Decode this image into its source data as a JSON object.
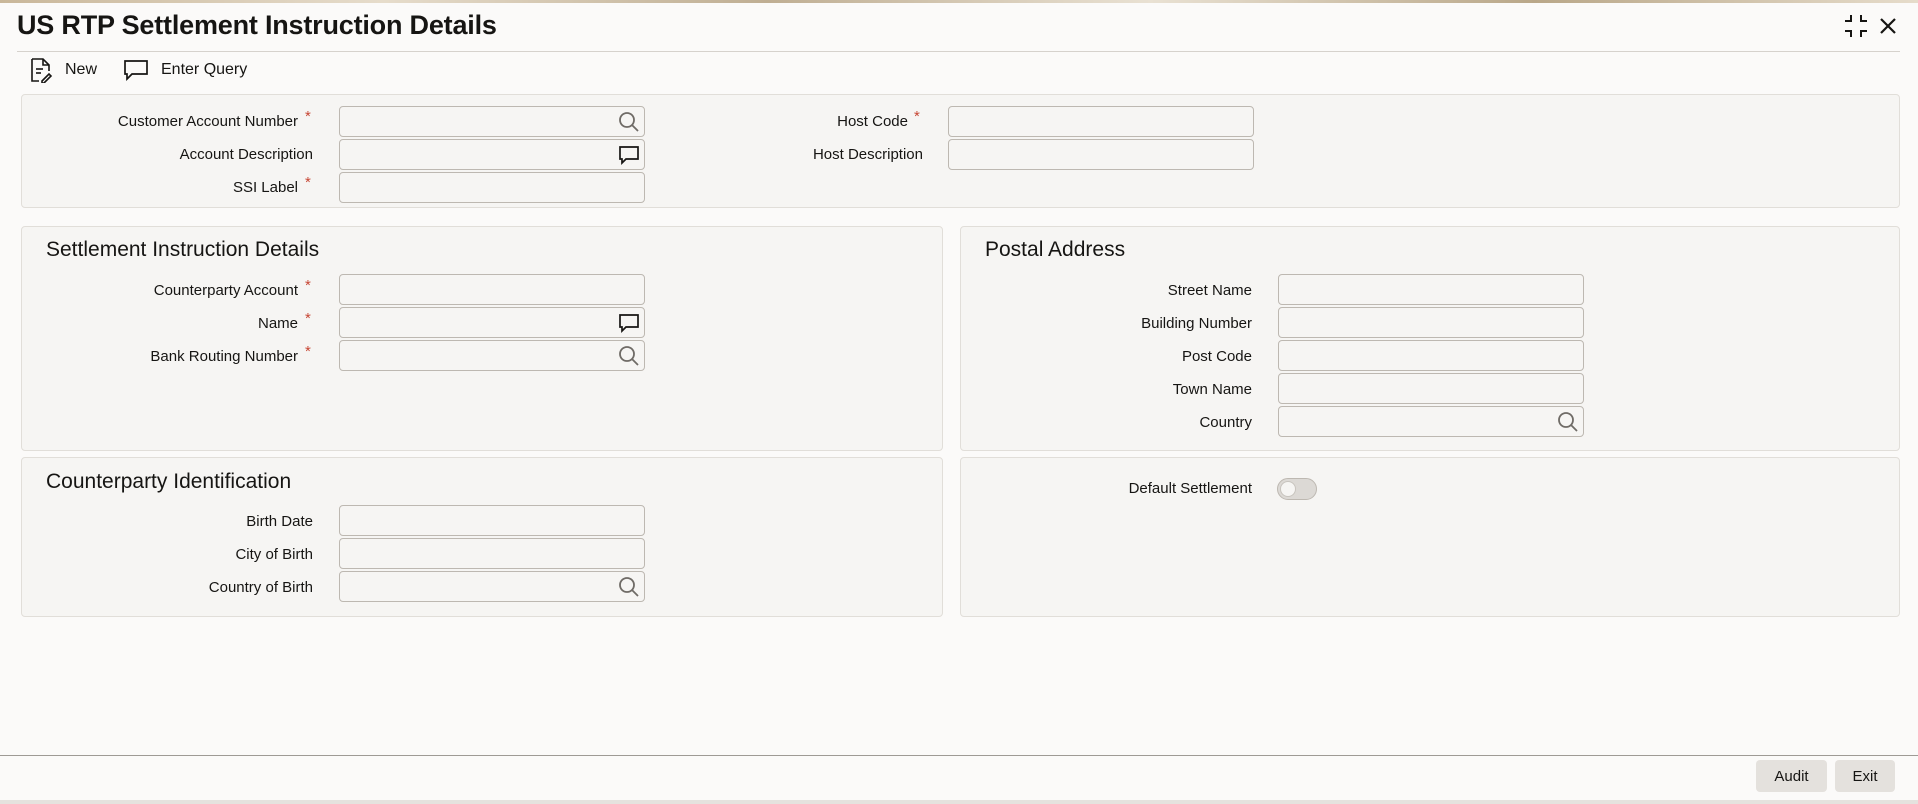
{
  "window": {
    "title": "US RTP Settlement Instruction Details"
  },
  "toolbar": {
    "new_label": "New",
    "enter_query_label": "Enter Query"
  },
  "header_section": {
    "customer_account_number": {
      "label": "Customer Account Number",
      "required": "*",
      "value": ""
    },
    "account_description": {
      "label": "Account Description",
      "value": ""
    },
    "ssi_label": {
      "label": "SSI Label",
      "required": "*",
      "value": ""
    },
    "host_code": {
      "label": "Host Code",
      "required": "*",
      "value": ""
    },
    "host_description": {
      "label": "Host Description",
      "value": ""
    }
  },
  "settlement_instruction": {
    "title": "Settlement Instruction Details",
    "counterparty_account": {
      "label": "Counterparty Account",
      "required": "*",
      "value": ""
    },
    "name": {
      "label": "Name",
      "required": "*",
      "value": ""
    },
    "bank_routing_number": {
      "label": "Bank Routing Number",
      "required": "*",
      "value": ""
    }
  },
  "postal_address": {
    "title": "Postal Address",
    "street_name": {
      "label": "Street Name",
      "value": ""
    },
    "building_number": {
      "label": "Building Number",
      "value": ""
    },
    "post_code": {
      "label": "Post Code",
      "value": ""
    },
    "town_name": {
      "label": "Town Name",
      "value": ""
    },
    "country": {
      "label": "Country",
      "value": ""
    }
  },
  "counterparty_identification": {
    "title": "Counterparty Identification",
    "birth_date": {
      "label": "Birth Date",
      "value": ""
    },
    "city_of_birth": {
      "label": "City of Birth",
      "value": ""
    },
    "country_of_birth": {
      "label": "Country of Birth",
      "value": ""
    }
  },
  "default_settlement": {
    "label": "Default Settlement",
    "enabled": false
  },
  "footer": {
    "audit_label": "Audit",
    "exit_label": "Exit"
  },
  "colors": {
    "required_marker": "#c74634",
    "panel_bg": "#f6f5f3",
    "field_border": "#bdb8b1"
  },
  "icons": [
    "maximize-icon",
    "close-icon",
    "new-document-icon",
    "enter-query-icon",
    "search-icon",
    "chat-bubble-icon"
  ]
}
